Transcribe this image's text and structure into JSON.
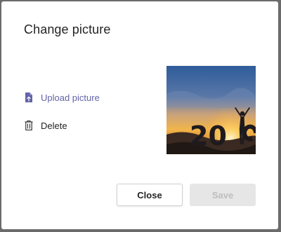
{
  "dialog": {
    "title": "Change picture",
    "upload_label": "Upload picture",
    "delete_label": "Delete",
    "close_label": "Close",
    "save_label": "Save",
    "photo_text": "20"
  },
  "colors": {
    "accent": "#6264a7",
    "save_disabled_bg": "#e6e6e6",
    "save_disabled_text": "#bdbdbd"
  },
  "icons": {
    "upload": "file-upload-icon",
    "delete": "trash-icon"
  }
}
